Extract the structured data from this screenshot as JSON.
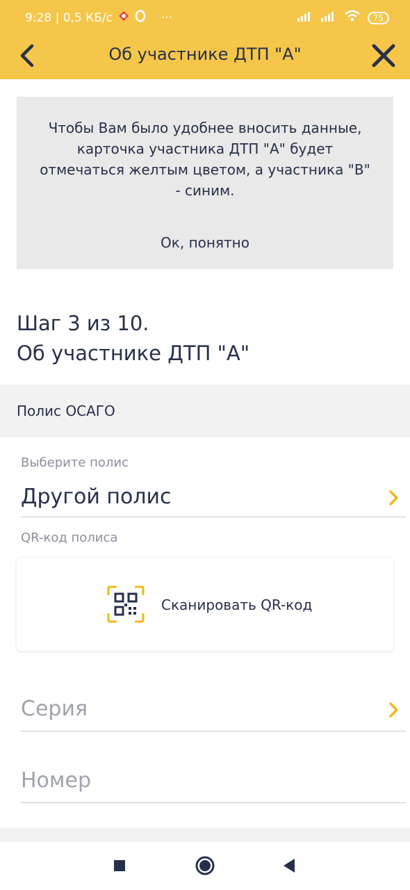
{
  "status_bar": {
    "time_speed": "9:28 | 0,5 КБ/с",
    "dots": "···",
    "battery": "75"
  },
  "app_bar": {
    "title": "Об участнике ДТП \"А\""
  },
  "info_card": {
    "text": "Чтобы Вам было удобнее вносить данные, карточка участника ДТП \"А\" будет отмечаться желтым цветом, а участника \"В\" - синим.",
    "ok_label": "Ок, понятно"
  },
  "step": {
    "line1": "Шаг 3 из 10.",
    "line2": "Об участнике ДТП \"А\""
  },
  "section": {
    "title": "Полис ОСАГО"
  },
  "policy_select": {
    "label": "Выберите полис",
    "value": "Другой полис"
  },
  "qr": {
    "label": "QR-код полиса",
    "button_label": "Сканировать QR-код"
  },
  "series": {
    "placeholder": "Серия"
  },
  "number": {
    "placeholder": "Номер"
  },
  "colors": {
    "header": "#f5c64a",
    "accent": "#f2b81b",
    "text": "#27304a"
  },
  "icons": [
    "back-arrow-icon",
    "close-icon",
    "chevron-right-icon",
    "qr-code-icon",
    "nav-square-icon",
    "nav-home-icon",
    "nav-back-icon"
  ]
}
